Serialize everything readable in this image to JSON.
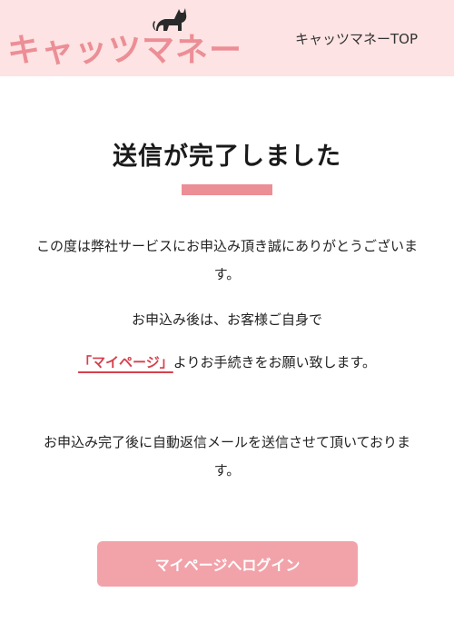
{
  "header": {
    "logo_text": "キャッツマネー",
    "top_link_label": "キャッツマネーTOP",
    "logo_icon": "cat-icon"
  },
  "main": {
    "title": "送信が完了しました",
    "paragraph1": "この度は弊社サービスにお申込み頂き誠にありがとうございます。",
    "paragraph2": "お申込み後は、お客様ご自身で",
    "paragraph3_link": "「マイページ」",
    "paragraph3_rest": "よりお手続きをお願い致します。",
    "paragraph4": "お申込み完了後に自動返信メールを送信させて頂いております。",
    "login_button_label": "マイページへログイン"
  },
  "colors": {
    "header_bg": "#fde3e3",
    "accent": "#ec8e96",
    "link": "#d6404d",
    "button": "#f2a3aa"
  }
}
